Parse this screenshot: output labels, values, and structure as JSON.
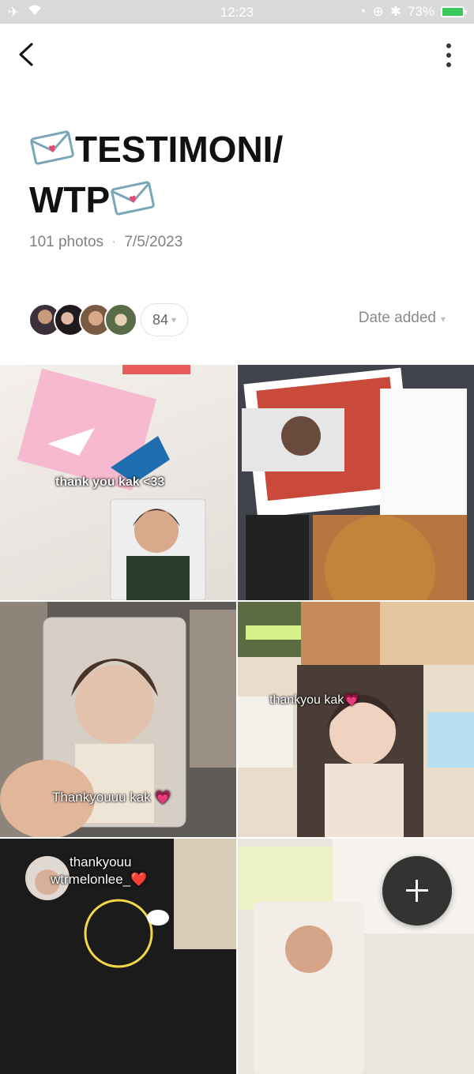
{
  "status_bar": {
    "time": "12:23",
    "battery": "73%"
  },
  "album": {
    "title_line1": "TESTIMONI/",
    "title_line2": "WTP",
    "photo_count": "101 photos",
    "date": "7/5/2023"
  },
  "members": {
    "count": "84"
  },
  "sort": {
    "label": "Date added"
  },
  "photos": [
    {
      "caption": "thank you kak <33",
      "bg": "#efe9e4"
    },
    {
      "caption": "",
      "bg": "#c9433a"
    },
    {
      "caption": "Thankyouuu kak 💗",
      "bg": "#6f5f52"
    },
    {
      "caption": "thankyou kak💗",
      "bg": "#d8c2ae"
    },
    {
      "caption_line1": "thankyouu",
      "caption_line2": "wtrmelonlee_❤️",
      "bg": "#1d1d1d"
    },
    {
      "caption": "",
      "bg": "#e9e6e0"
    }
  ],
  "colors": {
    "accent": "#37c85c",
    "fab": "#333333"
  },
  "icons": [
    "airplane-icon",
    "wifi-icon",
    "back-icon",
    "more-icon",
    "envelope-icon",
    "plus-icon",
    "chevron-down-icon"
  ]
}
